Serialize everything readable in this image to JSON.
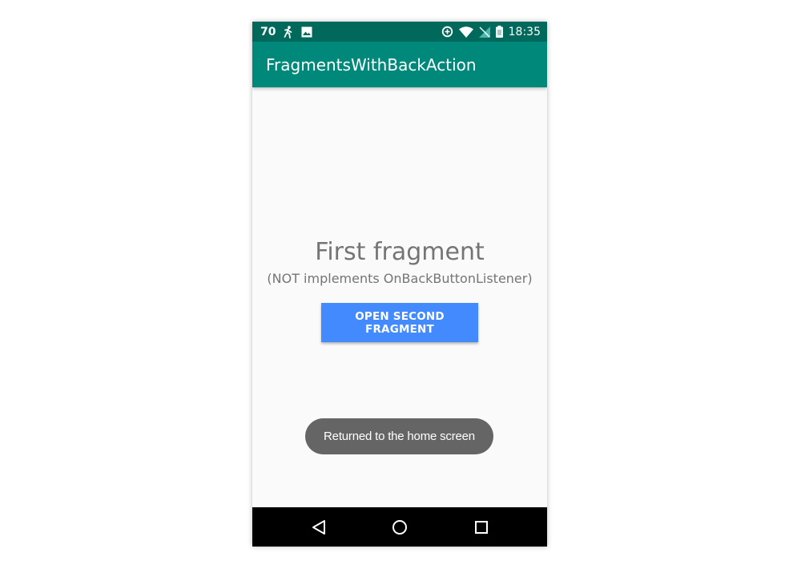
{
  "status_bar": {
    "notification_count": "70",
    "time": "18:35",
    "background": "#00695c",
    "icons_left": [
      "accessibility-icon",
      "image-icon"
    ],
    "icons_right": [
      "data-saver-icon",
      "wifi-icon",
      "no-signal-icon",
      "battery-icon"
    ]
  },
  "app_bar": {
    "title": "FragmentsWithBackAction",
    "background": "#00897b"
  },
  "fragment": {
    "title": "First fragment",
    "subtitle": "(NOT implements OnBackButtonListener)",
    "button_label": "OPEN SECOND FRAGMENT",
    "button_color": "#448aff"
  },
  "toast": {
    "message": "Returned to the home screen"
  },
  "nav_bar": {
    "buttons": [
      "back-icon",
      "home-icon",
      "recents-icon"
    ]
  }
}
